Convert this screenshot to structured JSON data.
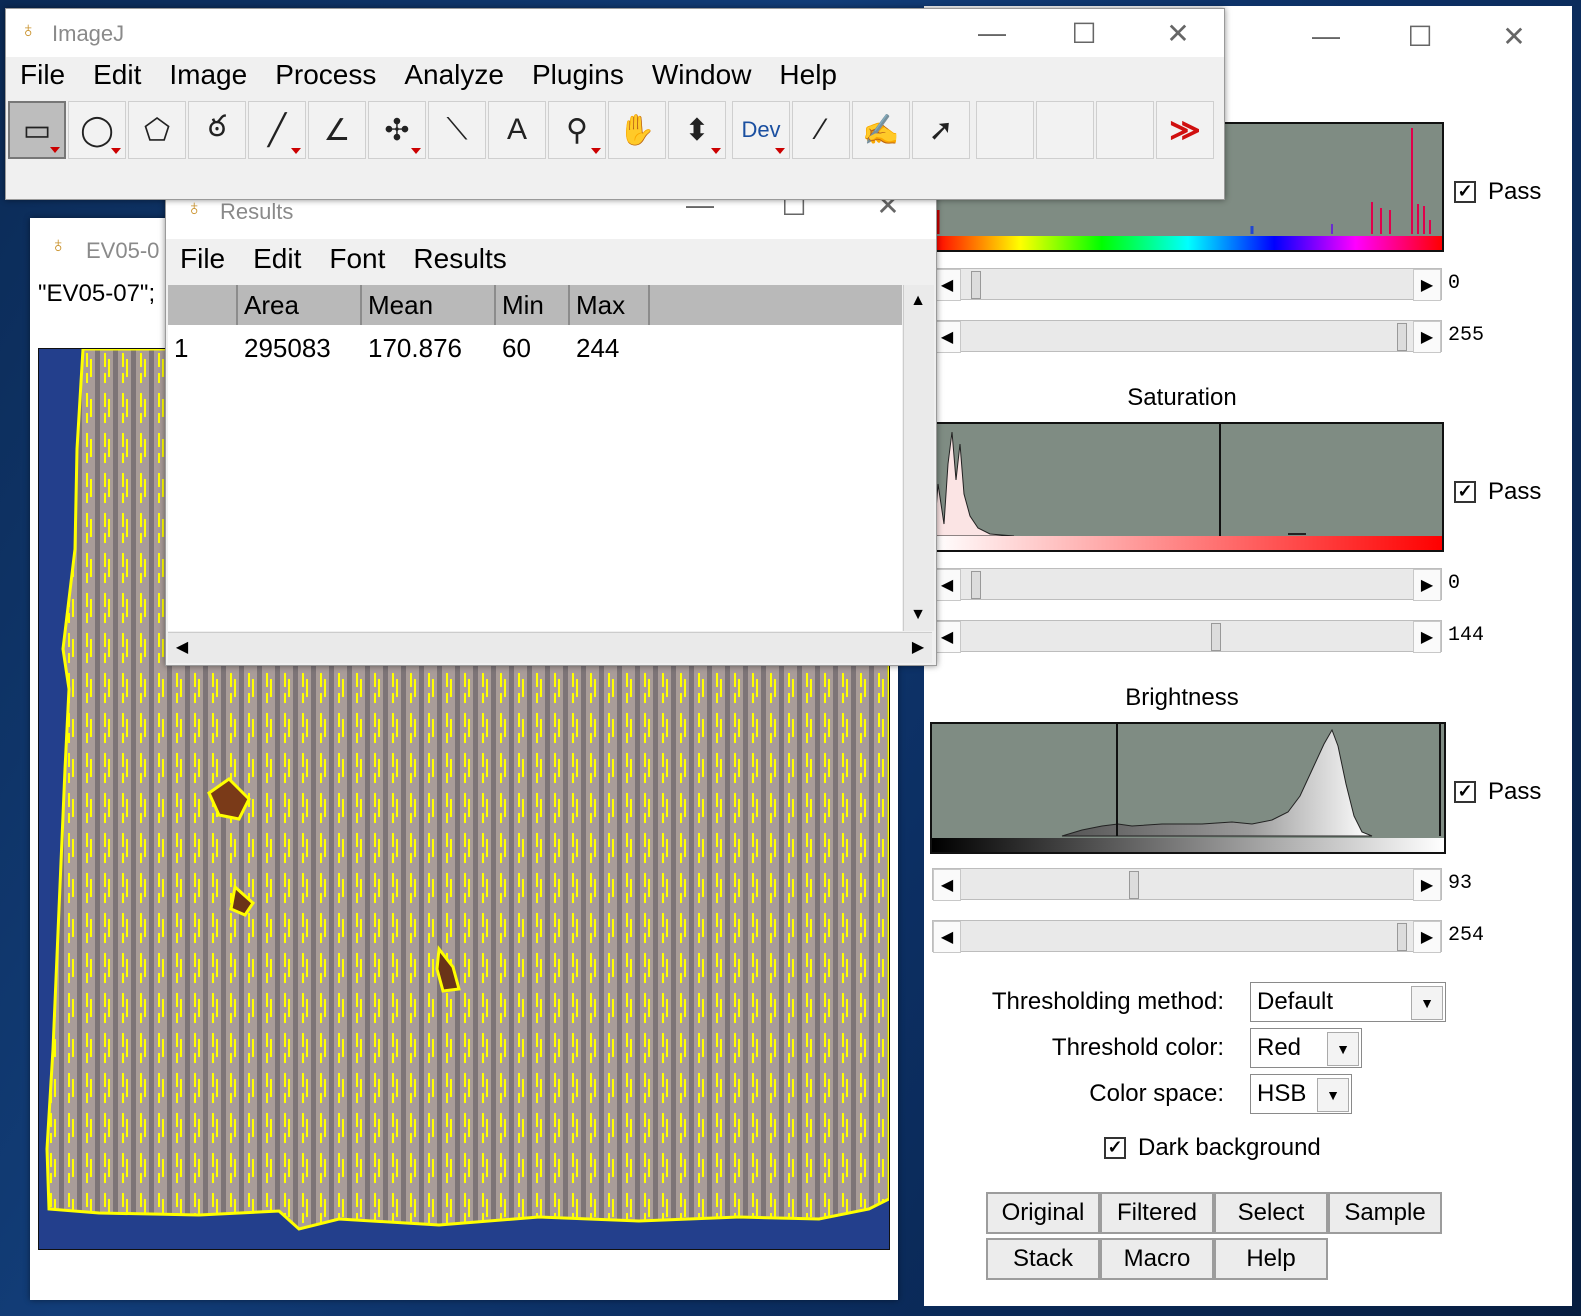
{
  "imagej": {
    "title": "ImageJ",
    "menu": [
      "File",
      "Edit",
      "Image",
      "Process",
      "Analyze",
      "Plugins",
      "Window",
      "Help"
    ],
    "tools": [
      {
        "name": "rectangle-tool-icon",
        "glyph": "▭",
        "dropdown": true,
        "selected": true
      },
      {
        "name": "oval-tool-icon",
        "glyph": "◯",
        "dropdown": true
      },
      {
        "name": "polygon-tool-icon",
        "glyph": "⬠",
        "dropdown": false
      },
      {
        "name": "freehand-tool-icon",
        "glyph": "ఠ",
        "dropdown": false
      },
      {
        "name": "line-tool-icon",
        "glyph": "╱",
        "dropdown": true
      },
      {
        "name": "angle-tool-icon",
        "glyph": "∠",
        "dropdown": false
      },
      {
        "name": "point-tool-icon",
        "glyph": "✣",
        "dropdown": true
      },
      {
        "name": "wand-tool-icon",
        "glyph": "⟍",
        "dropdown": false
      },
      {
        "name": "text-tool-icon",
        "glyph": "A",
        "dropdown": false
      },
      {
        "name": "magnifier-tool-icon",
        "glyph": "⚲",
        "dropdown": true
      },
      {
        "name": "hand-tool-icon",
        "glyph": "✋",
        "dropdown": false
      },
      {
        "name": "color-picker-tool-icon",
        "glyph": "⬍",
        "dropdown": true
      },
      {
        "name": "dev-tool-icon",
        "glyph": "Dev",
        "dropdown": true
      },
      {
        "name": "brush-tool-icon",
        "glyph": "⁄",
        "dropdown": false
      },
      {
        "name": "flood-fill-tool-icon",
        "glyph": "✍",
        "dropdown": false
      },
      {
        "name": "arrow-tool-icon",
        "glyph": "➚",
        "dropdown": false
      },
      {
        "name": "empty-slot-1",
        "glyph": "",
        "dropdown": false
      },
      {
        "name": "empty-slot-2",
        "glyph": "",
        "dropdown": false
      },
      {
        "name": "empty-slot-3",
        "glyph": "",
        "dropdown": false
      },
      {
        "name": "more-tools-icon",
        "glyph": "≫",
        "dropdown": false
      }
    ]
  },
  "results": {
    "title": "Results",
    "menu": [
      "File",
      "Edit",
      "Font",
      "Results"
    ],
    "columns": [
      "",
      "Area",
      "Mean",
      "Min",
      "Max"
    ],
    "rows": [
      [
        "1",
        "295083",
        "170.876",
        "60",
        "244"
      ]
    ]
  },
  "image_window": {
    "title": "EV05-0",
    "subtitle": "\"EV05-07\";"
  },
  "threshold": {
    "hue": {
      "pass_label": "Pass",
      "min": "0",
      "max": "255",
      "min_frac": 0.0,
      "max_frac": 1.0
    },
    "saturation": {
      "title": "Saturation",
      "pass_label": "Pass",
      "min": "0",
      "max": "144",
      "min_frac": 0.0,
      "max_frac": 0.565
    },
    "brightness": {
      "title": "Brightness",
      "pass_label": "Pass",
      "min": "93",
      "max": "254",
      "min_frac": 0.365,
      "max_frac": 0.996
    },
    "method_label": "Thresholding method:",
    "method_value": "Default",
    "color_label": "Threshold color:",
    "color_value": "Red",
    "space_label": "Color space:",
    "space_value": "HSB",
    "dark_background": "Dark background",
    "buttons": [
      "Original",
      "Filtered",
      "Select",
      "Sample",
      "Stack",
      "Macro",
      "Help"
    ]
  },
  "colors": {
    "threshold_outline": "#ffff00",
    "histogram_bg": "#7f8c83",
    "desktop_blue": "#123d78"
  }
}
